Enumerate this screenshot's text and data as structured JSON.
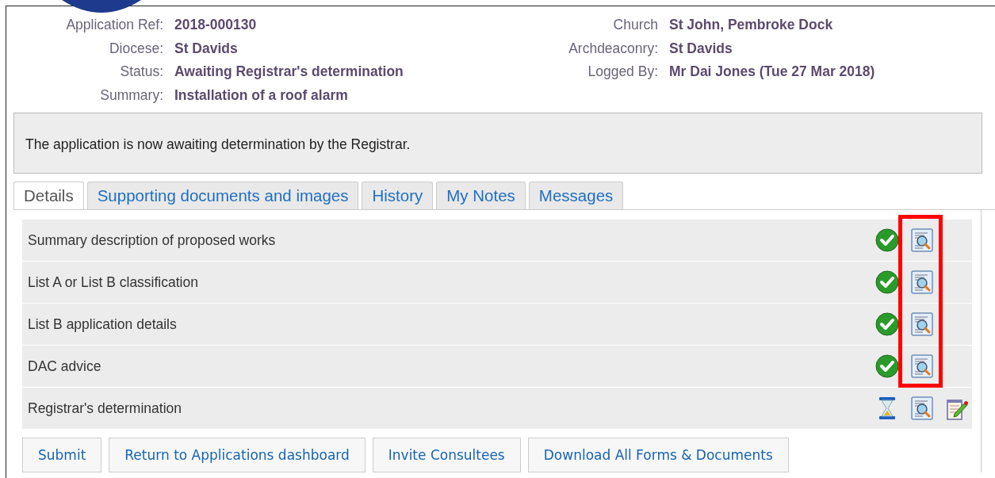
{
  "header": {
    "left": [
      {
        "label": "Application Ref:",
        "value": "2018-000130"
      },
      {
        "label": "Diocese:",
        "value": "St Davids"
      },
      {
        "label": "Status:",
        "value": "Awaiting Registrar's determination"
      },
      {
        "label": "Summary:",
        "value": "Installation of a roof alarm"
      }
    ],
    "right": [
      {
        "label": "Church",
        "value": "St John, Pembroke Dock"
      },
      {
        "label": "Archdeaconry:",
        "value": "St Davids"
      },
      {
        "label": "Logged By:",
        "value": "Mr Dai Jones (Tue 27 Mar 2018)"
      }
    ]
  },
  "message": "The application is now awaiting determination by the Registrar.",
  "tabs": [
    {
      "label": "Details",
      "selected": true
    },
    {
      "label": "Supporting documents and images",
      "selected": false
    },
    {
      "label": "History",
      "selected": false
    },
    {
      "label": "My Notes",
      "selected": false
    },
    {
      "label": "Messages",
      "selected": false
    }
  ],
  "sections": [
    {
      "title": "Summary description of proposed works",
      "complete": true,
      "editable": false,
      "highlighted": true
    },
    {
      "title": "List A or List B classification",
      "complete": true,
      "editable": false,
      "highlighted": true
    },
    {
      "title": "List B application details",
      "complete": true,
      "editable": false,
      "highlighted": true
    },
    {
      "title": "DAC advice",
      "complete": true,
      "editable": false,
      "highlighted": true
    },
    {
      "title": "Registrar's determination",
      "complete": false,
      "editable": true,
      "highlighted": false
    }
  ],
  "buttons": [
    "Submit",
    "Return to Applications dashboard",
    "Invite Consultees",
    "Download All Forms & Documents"
  ]
}
